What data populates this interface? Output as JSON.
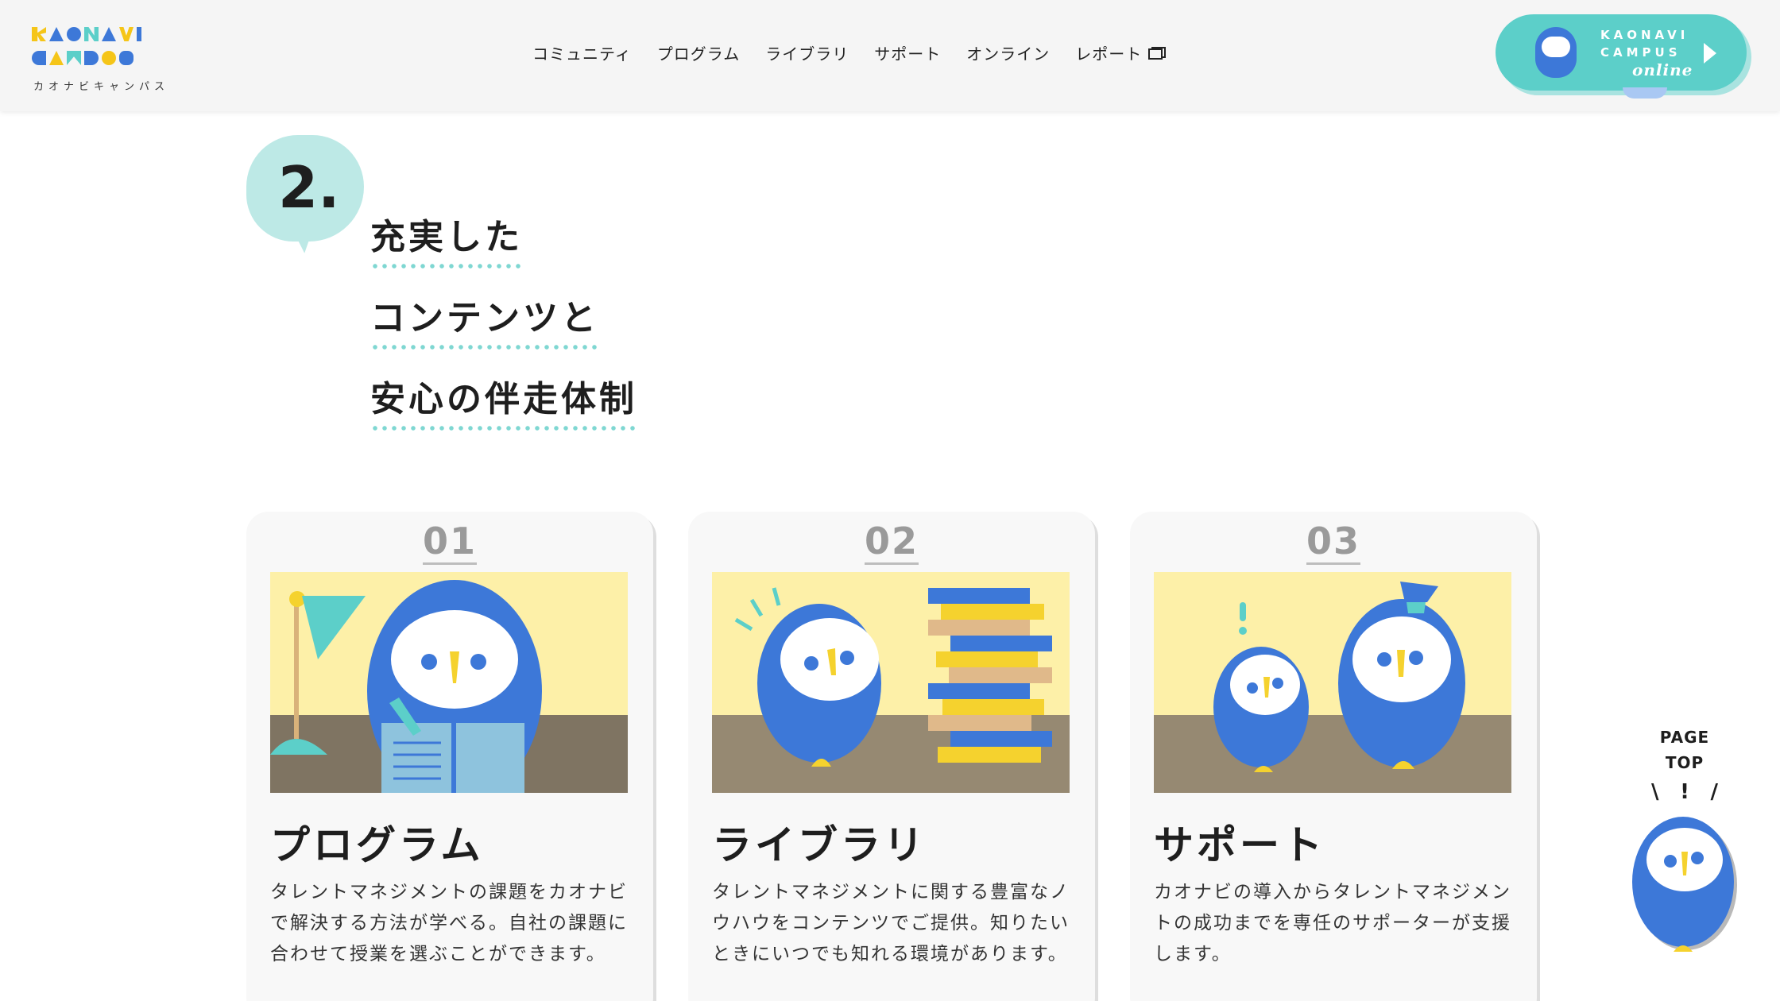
{
  "header": {
    "logo_sub": "カオナビキャンパス",
    "nav": [
      {
        "label": "コミュニティ"
      },
      {
        "label": "プログラム"
      },
      {
        "label": "ライブラリ"
      },
      {
        "label": "サポート"
      },
      {
        "label": "オンライン"
      },
      {
        "label": "レポート"
      }
    ],
    "online_button": {
      "brand_line1": "KAONAVI",
      "brand_line2": "CAMPUS",
      "brand_line3": "online"
    }
  },
  "section": {
    "number": "2.",
    "headline_lines": [
      "充実した",
      "コンテンツと",
      "安心の伴走体制"
    ]
  },
  "cards": [
    {
      "num": "01",
      "title": "プログラム",
      "desc": "タレントマネジメントの課題をカオナビで解決する方法が学べる。自社の課題に合わせて授業を選ぶことができます。"
    },
    {
      "num": "02",
      "title": "ライブラリ",
      "desc": "タレントマネジメントに関する豊富なノウハウをコンテンツでご提供。知りたいときにいつでも知れる環境があります。"
    },
    {
      "num": "03",
      "title": "サポート",
      "desc": "カオナビの導入からタレントマネジメントの成功までを専任のサポーターが支援します。"
    }
  ],
  "pagetop": {
    "line1": "PAGE",
    "line2": "TOP",
    "marks": [
      "\\",
      "!",
      "/"
    ]
  },
  "colors": {
    "owl_blue": "#3d78d8",
    "accent_teal": "#5ccfc9",
    "illus_bg": "#fdf0a8",
    "illus_floor": "#8f8371",
    "yellow": "#f5d22e"
  }
}
